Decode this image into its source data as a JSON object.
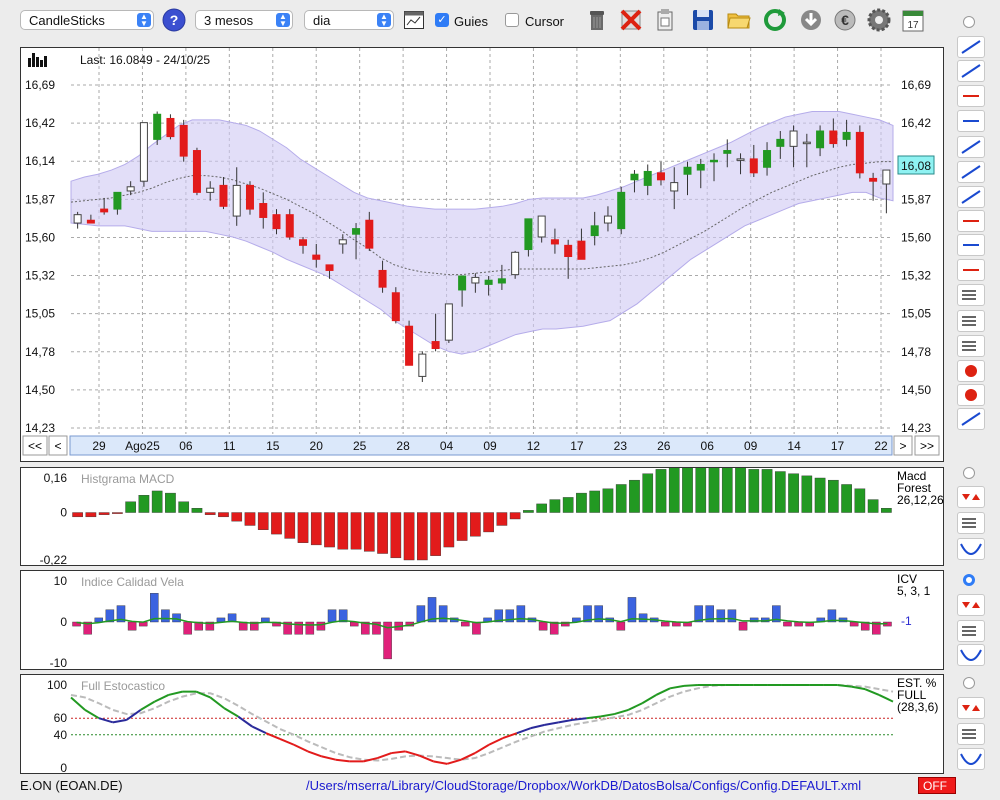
{
  "toolbar": {
    "chart_type": "CandleSticks",
    "period": "3 mesos",
    "interval": "dia",
    "guides_label": "Guies",
    "guides_checked": true,
    "cursor_label": "Cursor",
    "cursor_checked": false,
    "icons": [
      "help-icon",
      "line-chart-icon",
      "trash-icon",
      "delete-icon",
      "clipboard-icon",
      "save-icon",
      "open-folder-icon",
      "refresh-icon",
      "download-icon",
      "euro-icon",
      "settings-icon",
      "calendar-icon"
    ],
    "calendar_day": "17"
  },
  "main_chart": {
    "last_label": "Last: 16.0849 - 24/10/25",
    "y_ticks": [
      "16,69",
      "16,42",
      "16,14",
      "15,87",
      "15,60",
      "15,32",
      "15,05",
      "14,78",
      "14,50",
      "14,23"
    ],
    "current_price_label": "16,08",
    "x_ticks": [
      "29",
      "Ago25",
      "06",
      "11",
      "15",
      "20",
      "25",
      "28",
      "04",
      "09",
      "12",
      "17",
      "23",
      "26",
      "06",
      "09",
      "14",
      "17",
      "22"
    ],
    "nav": {
      "first": "<<",
      "prev": "<",
      "next": ">",
      "last": ">>"
    }
  },
  "macd": {
    "title": "Histgrama MACD",
    "y_ticks": [
      "0,16",
      "0",
      "-0,22"
    ],
    "legend": [
      "Macd",
      "Forest",
      "26,12,26"
    ]
  },
  "icv": {
    "title": "Indice Calidad Vela",
    "y_ticks": [
      "10",
      "0",
      "-10"
    ],
    "legend": [
      "ICV",
      "5, 3, 1"
    ],
    "value_label": "-1"
  },
  "stoch": {
    "title": "Full Estocastico",
    "y_ticks": [
      "100",
      "60",
      "40",
      "0"
    ],
    "legend": [
      "EST. %",
      "FULL",
      "(28,3,6)"
    ]
  },
  "status_bar": {
    "ticker": "E.ON (EOAN.DE)",
    "path": "/Users/mserra/Library/CloudStorage/Dropbox/WorkDB/DatosBolsa/Configs/Config.DEFAULT.xml",
    "off_label": "OFF"
  },
  "colors": {
    "up": "#229922",
    "down": "#e21b1b",
    "band": "#cfc8f3",
    "accent": "#2f7cf6",
    "icv_up": "#3b63e0",
    "icv_down": "#e0207a",
    "stoch_k_red": "#e21b1b",
    "stoch_k_blue": "#2a2a9a",
    "stoch_k_green": "#229922"
  },
  "chart_data": [
    {
      "type": "candlestick",
      "title": "",
      "ylim": [
        14.23,
        16.69
      ],
      "candles": [
        {
          "o": 15.7,
          "h": 15.78,
          "l": 15.66,
          "c": 15.76
        },
        {
          "o": 15.72,
          "h": 15.76,
          "l": 15.7,
          "c": 15.7
        },
        {
          "o": 15.8,
          "h": 15.88,
          "l": 15.76,
          "c": 15.78
        },
        {
          "o": 15.8,
          "h": 15.9,
          "l": 15.76,
          "c": 15.92
        },
        {
          "o": 15.93,
          "h": 16.0,
          "l": 15.9,
          "c": 15.96
        },
        {
          "o": 16.0,
          "h": 16.42,
          "l": 15.96,
          "c": 16.42
        },
        {
          "o": 16.3,
          "h": 16.5,
          "l": 16.26,
          "c": 16.48
        },
        {
          "o": 16.45,
          "h": 16.48,
          "l": 16.3,
          "c": 16.32
        },
        {
          "o": 16.4,
          "h": 16.44,
          "l": 16.14,
          "c": 16.18
        },
        {
          "o": 16.22,
          "h": 16.24,
          "l": 15.9,
          "c": 15.92
        },
        {
          "o": 15.92,
          "h": 16.0,
          "l": 15.86,
          "c": 15.95
        },
        {
          "o": 15.97,
          "h": 16.03,
          "l": 15.8,
          "c": 15.82
        },
        {
          "o": 15.75,
          "h": 16.1,
          "l": 15.68,
          "c": 15.97
        },
        {
          "o": 15.97,
          "h": 16.0,
          "l": 15.76,
          "c": 15.8
        },
        {
          "o": 15.84,
          "h": 15.92,
          "l": 15.66,
          "c": 15.74
        },
        {
          "o": 15.76,
          "h": 15.8,
          "l": 15.62,
          "c": 15.66
        },
        {
          "o": 15.76,
          "h": 15.8,
          "l": 15.58,
          "c": 15.6
        },
        {
          "o": 15.58,
          "h": 15.6,
          "l": 15.48,
          "c": 15.54
        },
        {
          "o": 15.47,
          "h": 15.55,
          "l": 15.38,
          "c": 15.44
        },
        {
          "o": 15.4,
          "h": 15.4,
          "l": 15.3,
          "c": 15.36
        },
        {
          "o": 15.55,
          "h": 15.62,
          "l": 15.48,
          "c": 15.58
        },
        {
          "o": 15.62,
          "h": 15.7,
          "l": 15.44,
          "c": 15.66
        },
        {
          "o": 15.72,
          "h": 15.78,
          "l": 15.5,
          "c": 15.52
        },
        {
          "o": 15.36,
          "h": 15.43,
          "l": 15.2,
          "c": 15.24
        },
        {
          "o": 15.2,
          "h": 15.24,
          "l": 14.98,
          "c": 15.0
        },
        {
          "o": 14.96,
          "h": 15.0,
          "l": 14.68,
          "c": 14.68
        },
        {
          "o": 14.6,
          "h": 14.78,
          "l": 14.56,
          "c": 14.76
        },
        {
          "o": 14.85,
          "h": 15.05,
          "l": 14.78,
          "c": 14.8
        },
        {
          "o": 14.86,
          "h": 15.12,
          "l": 14.84,
          "c": 15.12
        },
        {
          "o": 15.22,
          "h": 15.28,
          "l": 15.1,
          "c": 15.32
        },
        {
          "o": 15.27,
          "h": 15.34,
          "l": 15.2,
          "c": 15.31
        },
        {
          "o": 15.26,
          "h": 15.32,
          "l": 15.18,
          "c": 15.29
        },
        {
          "o": 15.27,
          "h": 15.4,
          "l": 15.22,
          "c": 15.3
        },
        {
          "o": 15.33,
          "h": 15.5,
          "l": 15.3,
          "c": 15.49
        },
        {
          "o": 15.51,
          "h": 15.72,
          "l": 15.46,
          "c": 15.73
        },
        {
          "o": 15.6,
          "h": 15.75,
          "l": 15.56,
          "c": 15.75
        },
        {
          "o": 15.58,
          "h": 15.66,
          "l": 15.48,
          "c": 15.55
        },
        {
          "o": 15.54,
          "h": 15.58,
          "l": 15.3,
          "c": 15.46
        },
        {
          "o": 15.57,
          "h": 15.66,
          "l": 15.44,
          "c": 15.44
        },
        {
          "o": 15.61,
          "h": 15.78,
          "l": 15.54,
          "c": 15.68
        },
        {
          "o": 15.7,
          "h": 15.82,
          "l": 15.64,
          "c": 15.75
        },
        {
          "o": 15.66,
          "h": 15.96,
          "l": 15.62,
          "c": 15.92
        },
        {
          "o": 16.01,
          "h": 16.08,
          "l": 15.92,
          "c": 16.05
        },
        {
          "o": 15.97,
          "h": 16.12,
          "l": 15.9,
          "c": 16.07
        },
        {
          "o": 16.06,
          "h": 16.14,
          "l": 15.97,
          "c": 16.01
        },
        {
          "o": 15.93,
          "h": 16.1,
          "l": 15.8,
          "c": 15.99
        },
        {
          "o": 16.05,
          "h": 16.14,
          "l": 15.9,
          "c": 16.1
        },
        {
          "o": 16.08,
          "h": 16.16,
          "l": 15.95,
          "c": 16.12
        },
        {
          "o": 16.14,
          "h": 16.2,
          "l": 16.0,
          "c": 16.15
        },
        {
          "o": 16.2,
          "h": 16.3,
          "l": 16.1,
          "c": 16.22
        },
        {
          "o": 16.15,
          "h": 16.2,
          "l": 16.05,
          "c": 16.16
        },
        {
          "o": 16.16,
          "h": 16.26,
          "l": 16.03,
          "c": 16.06
        },
        {
          "o": 16.1,
          "h": 16.28,
          "l": 16.04,
          "c": 16.22
        },
        {
          "o": 16.25,
          "h": 16.36,
          "l": 16.16,
          "c": 16.3
        },
        {
          "o": 16.25,
          "h": 16.4,
          "l": 16.1,
          "c": 16.36
        },
        {
          "o": 16.28,
          "h": 16.34,
          "l": 16.1,
          "c": 16.28
        },
        {
          "o": 16.24,
          "h": 16.4,
          "l": 16.18,
          "c": 16.36
        },
        {
          "o": 16.36,
          "h": 16.45,
          "l": 16.24,
          "c": 16.27
        },
        {
          "o": 16.3,
          "h": 16.44,
          "l": 16.25,
          "c": 16.35
        },
        {
          "o": 16.35,
          "h": 16.4,
          "l": 16.02,
          "c": 16.06
        },
        {
          "o": 16.02,
          "h": 16.06,
          "l": 15.86,
          "c": 16.0
        },
        {
          "o": 15.98,
          "h": 16.08,
          "l": 15.77,
          "c": 16.08
        }
      ],
      "bollinger_upper": [
        16.0,
        16.03,
        16.05,
        16.08,
        16.12,
        16.18,
        16.26,
        16.33,
        16.4,
        16.44,
        16.44,
        16.44,
        16.42,
        16.4,
        16.36,
        16.3,
        16.24,
        16.16,
        16.1,
        16.04,
        15.98,
        15.92,
        15.88,
        15.86,
        15.84,
        15.82,
        15.81,
        15.8,
        15.8,
        15.8,
        15.8,
        15.81,
        15.82,
        15.84,
        15.87,
        15.88,
        15.88,
        15.88,
        15.88,
        15.9,
        15.93,
        15.96,
        16.0,
        16.04,
        16.08,
        16.12,
        16.16,
        16.2,
        16.24,
        16.28,
        16.33,
        16.38,
        16.42,
        16.46,
        16.48,
        16.5,
        16.5,
        16.5,
        16.48,
        16.46,
        16.44,
        16.4
      ],
      "bollinger_mid": [
        15.85,
        15.86,
        15.87,
        15.88,
        15.9,
        15.92,
        15.95,
        15.99,
        16.02,
        16.04,
        16.04,
        16.03,
        16.01,
        15.98,
        15.95,
        15.91,
        15.87,
        15.82,
        15.77,
        15.71,
        15.65,
        15.58,
        15.52,
        15.45,
        15.4,
        15.37,
        15.35,
        15.34,
        15.33,
        15.33,
        15.34,
        15.35,
        15.36,
        15.37,
        15.37,
        15.37,
        15.37,
        15.37,
        15.37,
        15.38,
        15.39,
        15.4,
        15.42,
        15.45,
        15.49,
        15.54,
        15.59,
        15.64,
        15.7,
        15.76,
        15.82,
        15.87,
        15.92,
        15.96,
        16.0,
        16.04,
        16.07,
        16.1,
        16.12,
        16.13,
        16.14,
        16.14
      ],
      "bollinger_lower": [
        15.7,
        15.69,
        15.68,
        15.68,
        15.68,
        15.66,
        15.64,
        15.64,
        15.64,
        15.64,
        15.64,
        15.62,
        15.6,
        15.57,
        15.53,
        15.49,
        15.44,
        15.4,
        15.36,
        15.32,
        15.26,
        15.2,
        15.14,
        15.08,
        15.0,
        14.94,
        14.88,
        14.82,
        14.78,
        14.76,
        14.78,
        14.82,
        14.86,
        14.9,
        14.92,
        14.94,
        14.94,
        14.95,
        14.96,
        14.98,
        15.0,
        15.06,
        15.12,
        15.2,
        15.28,
        15.36,
        15.44,
        15.5,
        15.56,
        15.62,
        15.68,
        15.72,
        15.76,
        15.8,
        15.84,
        15.86,
        15.88,
        15.9,
        15.92,
        15.92,
        15.88,
        15.86
      ]
    },
    {
      "type": "bar",
      "title": "Histgrama MACD",
      "ylim": [
        -0.22,
        0.16
      ],
      "values": [
        -0.02,
        -0.02,
        -0.01,
        -0.005,
        0.05,
        0.08,
        0.1,
        0.09,
        0.05,
        0.02,
        -0.01,
        -0.02,
        -0.04,
        -0.06,
        -0.08,
        -0.1,
        -0.12,
        -0.14,
        -0.15,
        -0.16,
        -0.17,
        -0.17,
        -0.18,
        -0.19,
        -0.21,
        -0.22,
        -0.22,
        -0.2,
        -0.16,
        -0.13,
        -0.11,
        -0.09,
        -0.06,
        -0.03,
        0.01,
        0.04,
        0.06,
        0.07,
        0.09,
        0.1,
        0.11,
        0.13,
        0.15,
        0.18,
        0.2,
        0.22,
        0.22,
        0.22,
        0.22,
        0.22,
        0.21,
        0.2,
        0.2,
        0.19,
        0.18,
        0.17,
        0.16,
        0.15,
        0.13,
        0.11,
        0.06,
        0.02
      ]
    },
    {
      "type": "bar",
      "title": "Indice Calidad Vela",
      "ylim": [
        -10,
        10
      ],
      "values": [
        -1,
        -3,
        1,
        3,
        4,
        -2,
        -1,
        7,
        3,
        2,
        -3,
        -2,
        -2,
        1,
        2,
        -2,
        -2,
        1,
        -1,
        -3,
        -3,
        -3,
        -2,
        3,
        3,
        -1,
        -3,
        -3,
        -9,
        -2,
        -1,
        4,
        6,
        4,
        1,
        -1,
        -3,
        1,
        3,
        3,
        4,
        1,
        -2,
        -3,
        -1,
        1,
        4,
        4,
        1,
        -2,
        6,
        2,
        1,
        -1,
        -1,
        -1,
        4,
        4,
        3,
        3,
        -2,
        1,
        1,
        4,
        -1,
        -1,
        -1,
        1,
        3,
        1,
        -1,
        -2,
        -3,
        -1
      ]
    },
    {
      "type": "line",
      "title": "Full Estocastico",
      "ylim": [
        0,
        100
      ],
      "series": [
        {
          "values": [
            85,
            70,
            60,
            55,
            58,
            70,
            80,
            88,
            92,
            92,
            85,
            72,
            62,
            50,
            42,
            35,
            28,
            20,
            14,
            10,
            8,
            8,
            12,
            18,
            20,
            15,
            8,
            5,
            10,
            18,
            28,
            36,
            42,
            48,
            52,
            55,
            58,
            60,
            62,
            65,
            70,
            78,
            88,
            96,
            99,
            100,
            100,
            100,
            100,
            100,
            100,
            100,
            100,
            100,
            100,
            100,
            98,
            95,
            88,
            80
          ]
        },
        {
          "values": [
            88,
            85,
            78,
            70,
            65,
            66,
            72,
            80,
            86,
            90,
            90,
            84,
            75,
            65,
            56,
            47,
            40,
            32,
            25,
            18,
            13,
            10,
            9,
            11,
            14,
            15,
            14,
            12,
            10,
            12,
            18,
            25,
            32,
            38,
            44,
            48,
            52,
            55,
            58,
            61,
            64,
            70,
            78,
            86,
            92,
            96,
            99,
            100,
            100,
            100,
            100,
            100,
            100,
            100,
            100,
            100,
            99,
            98,
            95,
            92
          ]
        }
      ]
    }
  ]
}
